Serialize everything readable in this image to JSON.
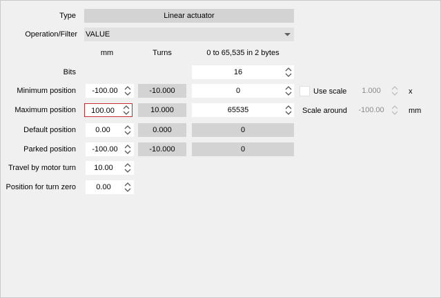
{
  "type": {
    "label": "Type",
    "value": "Linear actuator"
  },
  "operation_filter": {
    "label": "Operation/Filter",
    "value": "VALUE"
  },
  "headers": {
    "mm": "mm",
    "turns": "Turns",
    "range": "0 to 65,535 in 2 bytes"
  },
  "bits": {
    "label": "Bits",
    "value": "16"
  },
  "rows": {
    "min": {
      "label": "Minimum position",
      "mm": "-100.00",
      "turns": "-10.000",
      "raw": "0"
    },
    "max": {
      "label": "Maximum position",
      "mm": "100.00",
      "turns": "10.000",
      "raw": "65535"
    },
    "default": {
      "label": "Default position",
      "mm": "0.00",
      "turns": "0.000",
      "raw": "0"
    },
    "parked": {
      "label": "Parked position",
      "mm": "-100.00",
      "turns": "-10.000",
      "raw": "0"
    },
    "travel": {
      "label": "Travel by motor turn",
      "mm": "10.00"
    },
    "turn_zero": {
      "label": "Position for turn zero",
      "mm": "0.00"
    }
  },
  "scale": {
    "use_scale_label": "Use scale",
    "use_scale_checked": false,
    "scale_value": "1.000",
    "scale_unit": "x",
    "scale_around_label": "Scale around",
    "scale_around_value": "-100.00",
    "scale_around_unit": "mm"
  },
  "colors": {
    "focus_border": "#c42b2b",
    "readonly_bg": "#d3d3d3",
    "panel_bg": "#f0f0f0"
  }
}
